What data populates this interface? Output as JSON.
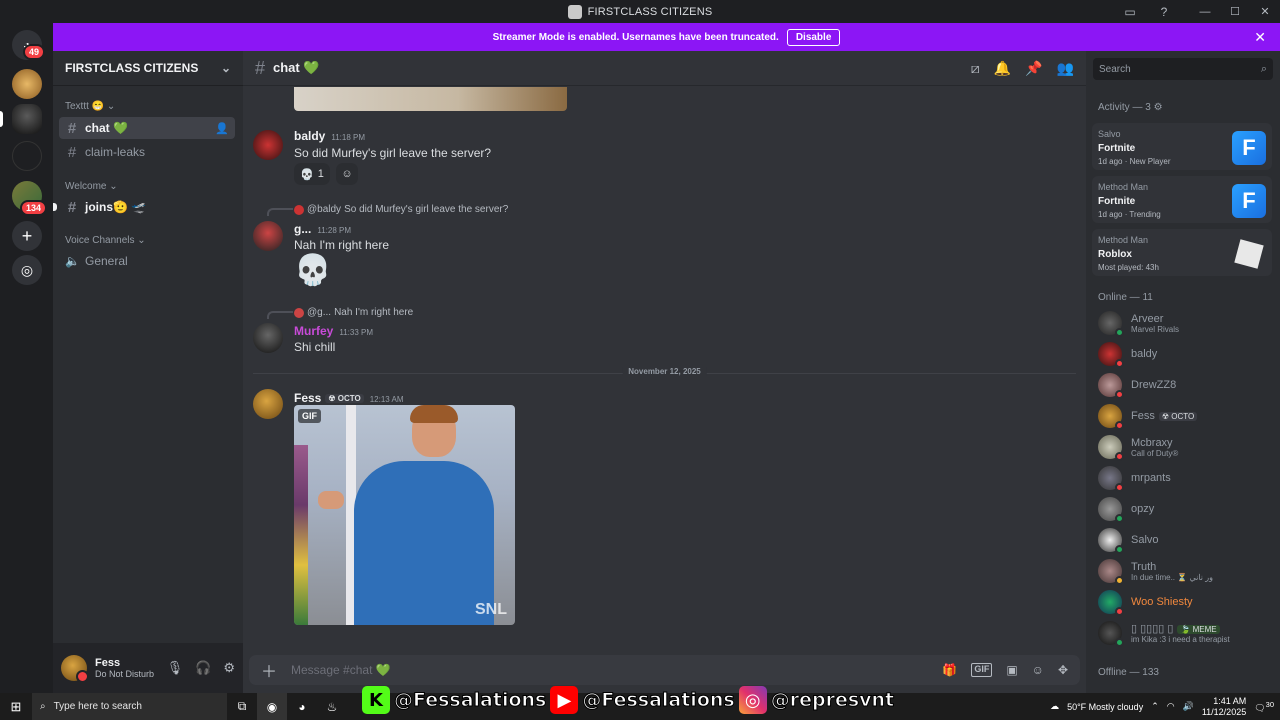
{
  "window": {
    "title": "FIRSTCLASS CITIZENS"
  },
  "rail": {
    "home_badge": "49",
    "group_badge": "134"
  },
  "banner": {
    "text": "Streamer Mode is enabled. Usernames have been truncated.",
    "button": "Disable"
  },
  "server": {
    "name": "FIRSTCLASS CITIZENS"
  },
  "categories": [
    {
      "label": "Texttt 😁"
    },
    {
      "label": "Welcome"
    },
    {
      "label": "Voice Channels"
    }
  ],
  "channels": [
    {
      "label": "chat 💚"
    },
    {
      "label": "claim-leaks"
    },
    {
      "label": "joins🫡 🛫"
    },
    {
      "label": "General"
    }
  ],
  "user_panel": {
    "name": "Fess",
    "status": "Do Not Disturb"
  },
  "chat": {
    "channel": "chat 💚",
    "messages": [
      {
        "author": "baldy",
        "time": "11:18 PM",
        "text": "So did Murfey's girl leave the server?",
        "reaction_count": "1"
      },
      {
        "reply_to": "@baldy",
        "reply_text": "So did Murfey's girl leave the server?",
        "author": "g...",
        "time": "11:28 PM",
        "text": "Nah I'm right here",
        "emoji": "💀"
      },
      {
        "reply_to": "@g...",
        "reply_text": "Nah I'm right here",
        "author": "Murfey",
        "time": "11:33 PM",
        "text": "Shi chill"
      },
      {
        "author": "Fess",
        "tag": "OCTO",
        "time": "12:13 AM",
        "gif_label": "GIF",
        "watermark": "SNL"
      }
    ],
    "date_divider": "November 12, 2025",
    "composer_placeholder": "Message #chat 💚"
  },
  "members": {
    "search_placeholder": "Search",
    "activity_header": "Activity — 3",
    "activities": [
      {
        "user": "Salvo",
        "game": "Fortnite",
        "meta": "1d ago · New Player",
        "art": "F"
      },
      {
        "user": "Method Man",
        "game": "Fortnite",
        "meta": "1d ago · Trending",
        "art": "F"
      },
      {
        "user": "Method Man",
        "game": "Roblox",
        "meta": "Most played: 43h",
        "art": ""
      }
    ],
    "online_header": "Online — 11",
    "online": [
      {
        "name": "Arveer",
        "sub": "Marvel Rivals"
      },
      {
        "name": "baldy",
        "sub": ""
      },
      {
        "name": "DrewZZ8",
        "sub": ""
      },
      {
        "name": "Fess",
        "sub": "",
        "tag": "OCTO"
      },
      {
        "name": "Mcbraxy",
        "sub": "Call of Duty®"
      },
      {
        "name": "mrpants",
        "sub": ""
      },
      {
        "name": "opzy",
        "sub": ""
      },
      {
        "name": "Salvo",
        "sub": ""
      },
      {
        "name": "Truth",
        "sub": "In due time.. ⏳ ور ناني"
      },
      {
        "name": "Woo Shiesty",
        "sub": ""
      },
      {
        "name": "▯ ▯▯▯▯ ▯",
        "sub": "im Kika :3 i need a therapist",
        "tag": "MEME"
      }
    ],
    "offline_header": "Offline — 133"
  },
  "taskbar": {
    "search_placeholder": "Type here to search",
    "social_kick": "@Fessalations",
    "social_youtube": "@Fessalations",
    "social_instagram": "@represvnt",
    "weather": "50°F  Mostly cloudy",
    "time": "1:41 AM",
    "date": "11/12/2025",
    "notif": "30"
  }
}
